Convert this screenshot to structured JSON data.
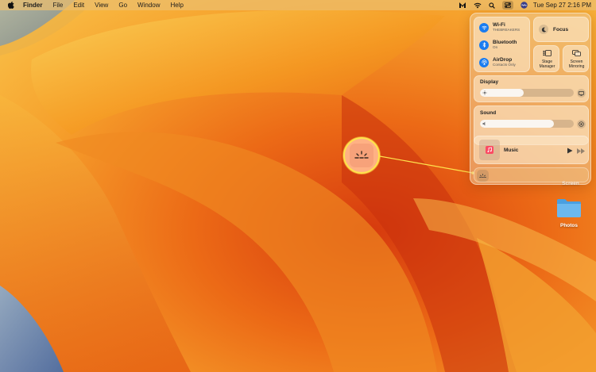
{
  "menu_bar": {
    "app_name": "Finder",
    "menus": [
      "File",
      "Edit",
      "View",
      "Go",
      "Window",
      "Help"
    ],
    "date_time": "Tue Sep 27  2:16 PM"
  },
  "control_center": {
    "wifi": {
      "title": "Wi-Fi",
      "subtitle": "THEBREAKERS"
    },
    "bluetooth": {
      "title": "Bluetooth",
      "subtitle": "On"
    },
    "airdrop": {
      "title": "AirDrop",
      "subtitle": "Contacts Only"
    },
    "focus": {
      "label": "Focus"
    },
    "stage_manager": {
      "label_line1": "Stage",
      "label_line2": "Manager"
    },
    "screen_mirroring": {
      "label_line1": "Screen",
      "label_line2": "Mirroring"
    },
    "display": {
      "label": "Display",
      "level": 0.47
    },
    "sound": {
      "label": "Sound",
      "level": 0.79
    },
    "now_playing": {
      "label": "Music"
    }
  },
  "desktop": {
    "folder_partial_label": "Screen",
    "photos_label": "Photos"
  },
  "colors": {
    "accent_blue": "#1a7cf0",
    "callout_yellow": "#ffe34d",
    "callout_fill": "#ffb184"
  }
}
